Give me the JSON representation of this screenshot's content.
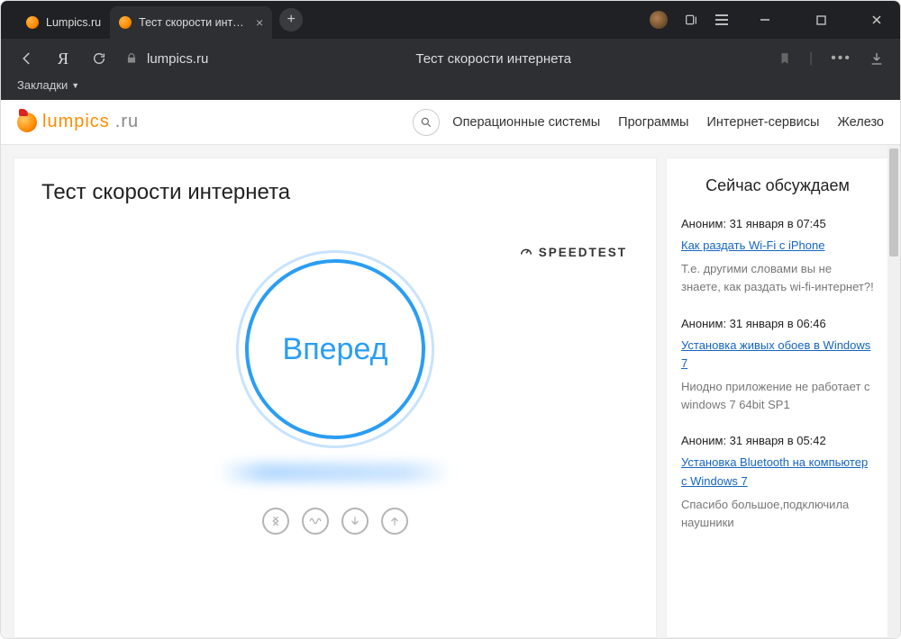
{
  "browser": {
    "tabs": [
      {
        "title": "Lumpics.ru",
        "active": false
      },
      {
        "title": "Тест скорости интернет",
        "active": true
      }
    ],
    "url_domain": "lumpics.ru",
    "page_title_bar": "Тест скорости интернета",
    "bookmarks_label": "Закладки"
  },
  "site": {
    "logo_primary": "lumpics",
    "logo_secondary": ".ru",
    "nav": [
      "Операционные системы",
      "Программы",
      "Интернет-сервисы",
      "Железо"
    ]
  },
  "page": {
    "heading": "Тест скорости интернета",
    "brand_label": "SPEEDTEST",
    "go_label": "Вперед"
  },
  "sidebar": {
    "title": "Сейчас обсуждаем",
    "comments": [
      {
        "meta": "Аноним: 31 января в 07:45",
        "link": "Как раздать Wi-Fi с iPhone",
        "body": "Т.е. другими словами вы не знаете, как раздать wi-fi-интернет?!"
      },
      {
        "meta": "Аноним: 31 января в 06:46",
        "link": "Установка живых обоев в Windows 7",
        "body": "Ниодно приложение не работает с windows 7 64bit SP1"
      },
      {
        "meta": "Аноним: 31 января в 05:42",
        "link": "Установка Bluetooth на компьютер с Windows 7",
        "body": "Спасибо большое,подключила наушники"
      }
    ]
  }
}
